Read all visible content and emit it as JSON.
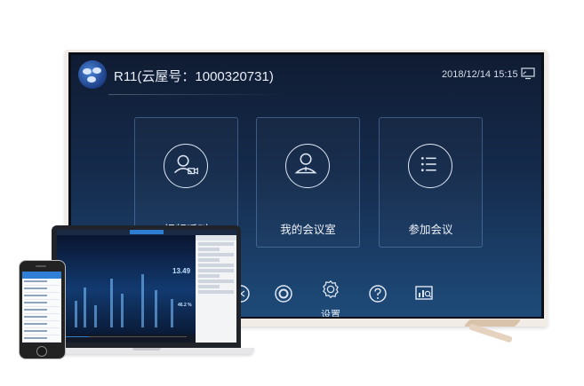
{
  "tv": {
    "title": "R11(云屋号：1000320731)",
    "datetime": "2018/12/14 15:15",
    "cards": [
      {
        "label": "视频呼叫",
        "icon": "video-call-icon"
      },
      {
        "label": "我的会议室",
        "icon": "my-meeting-room-icon"
      },
      {
        "label": "参加会议",
        "icon": "join-meeting-icon"
      }
    ],
    "bottom_bar": [
      {
        "icon": "power-icon"
      },
      {
        "icon": "ring-logo-icon"
      },
      {
        "icon": "settings-gear-icon",
        "label": "设置"
      },
      {
        "icon": "help-icon"
      },
      {
        "icon": "stats-icon"
      }
    ]
  },
  "laptop": {
    "video_number_1": "13.49",
    "video_number_2": "46.2 %"
  },
  "colors": {
    "accent": "#2d7dd2",
    "screen_top": "#101c33",
    "screen_bottom": "#1e4b7a"
  }
}
